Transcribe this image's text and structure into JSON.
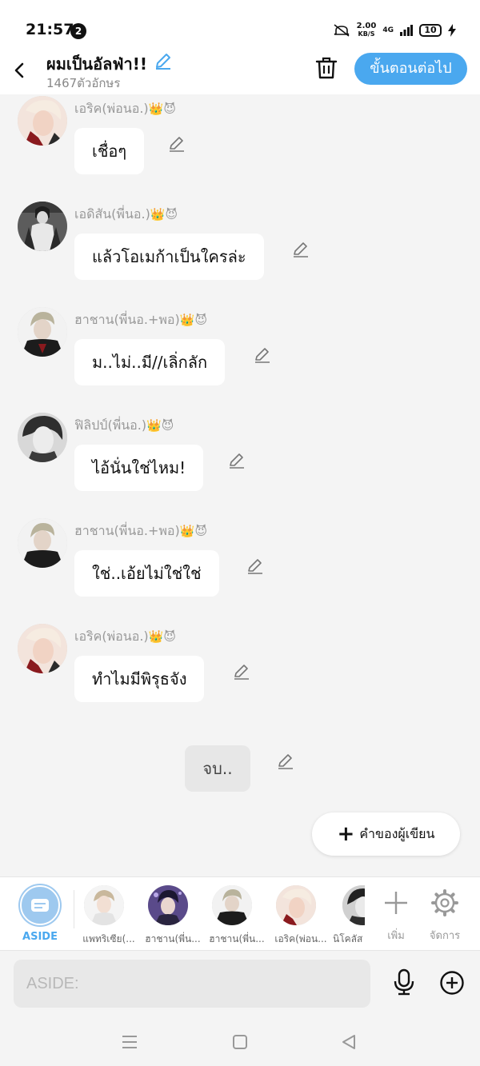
{
  "status_bar": {
    "time": "21:57",
    "notification_count": "2",
    "speed_value": "2.00",
    "speed_unit": "KB/S",
    "network": "4G",
    "battery": "10"
  },
  "header": {
    "title": "ผมเป็นอัลฟ่า!!",
    "char_count": "1467ตัวอักษร",
    "next_label": "ขั้นตอนต่อไป"
  },
  "messages": [
    {
      "sender": "เอริค(พ่อนอ.)",
      "emoji": "👑😈",
      "text": "เชื่อๆ"
    },
    {
      "sender": "เอดิสัน(พี่นอ.)",
      "emoji": "👑😈",
      "text": "แล้วโอเมก้าเป็นใครล่ะ"
    },
    {
      "sender": "ฮาชาน(พี่นอ.+พอ)",
      "emoji": "👑😈",
      "text": "ม..ไม่..มี//เลิ่กลัก"
    },
    {
      "sender": "ฟิลิปป์(พี่นอ.)",
      "emoji": "👑😈",
      "text": "ไอ้นั่นใช่ไหม!"
    },
    {
      "sender": "ฮาชาน(พี่นอ.+พอ)",
      "emoji": "👑😈",
      "text": "ใช่..เอ้ยไม่ใช่ใช่"
    },
    {
      "sender": "เอริค(พ่อนอ.)",
      "emoji": "👑😈",
      "text": "ทำไมมีพิรุธจัง"
    }
  ],
  "end_text": "จบ..",
  "author_note_label": "คำของผู้เขียน",
  "characters": {
    "aside_label": "ASIDE",
    "list": [
      {
        "name": "แพทริเซีย(..."
      },
      {
        "name": "ฮาชาน(พี่น..."
      },
      {
        "name": "ฮาชาน(พี่น..."
      },
      {
        "name": "เอริค(พ่อน..."
      },
      {
        "name": "นิโคลัส"
      }
    ],
    "add_label": "เพิ่ม",
    "manage_label": "จัดการ"
  },
  "input": {
    "placeholder": "ASIDE:"
  },
  "colors": {
    "accent": "#4aa8ef",
    "background": "#f4f4f4",
    "bubble": "#ffffff",
    "end_bubble": "#e7e7e7"
  }
}
